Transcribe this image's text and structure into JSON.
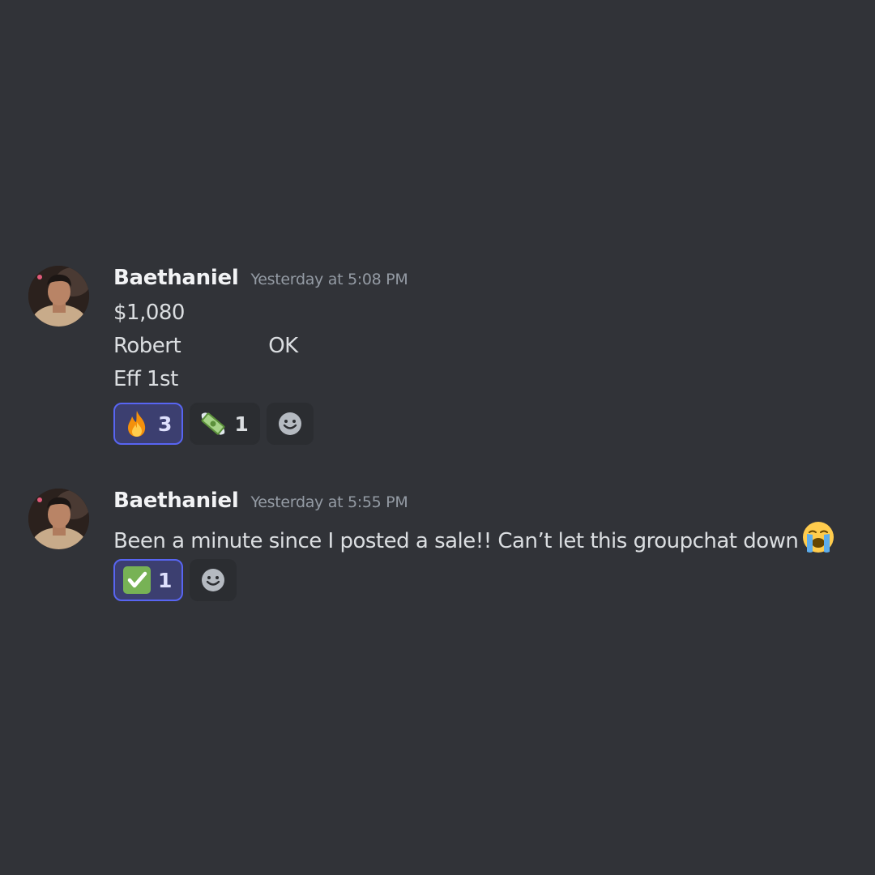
{
  "colors": {
    "background": "#313338",
    "username": "#f2f3f5",
    "timestamp": "#949ba4",
    "message_text": "#dbdee1",
    "reaction_bg": "#2b2d31",
    "reaction_active_bg": "#3c3f70",
    "reaction_active_border": "#5865f2"
  },
  "messages": [
    {
      "author": "Baethaniel",
      "timestamp": "Yesterday at 5:08 PM",
      "avatar_icon": "profile-photo",
      "lines": [
        "$1,080",
        "Robert",
        "OK",
        "Eff 1st"
      ],
      "reactions": [
        {
          "emoji": "fire",
          "count": "3",
          "active": true
        },
        {
          "emoji": "money-with-wings",
          "count": "1",
          "active": false
        }
      ],
      "add_reaction_icon": "smiley-add-reaction-icon"
    },
    {
      "author": "Baethaniel",
      "timestamp": "Yesterday at 5:55 PM",
      "avatar_icon": "profile-photo",
      "text": "Been a minute since I posted a sale!! Can’t let this groupchat down",
      "inline_emoji": "loudly-crying-face",
      "reactions": [
        {
          "emoji": "white-check-mark",
          "count": "1",
          "active": true
        }
      ],
      "add_reaction_icon": "smiley-add-reaction-icon"
    }
  ]
}
